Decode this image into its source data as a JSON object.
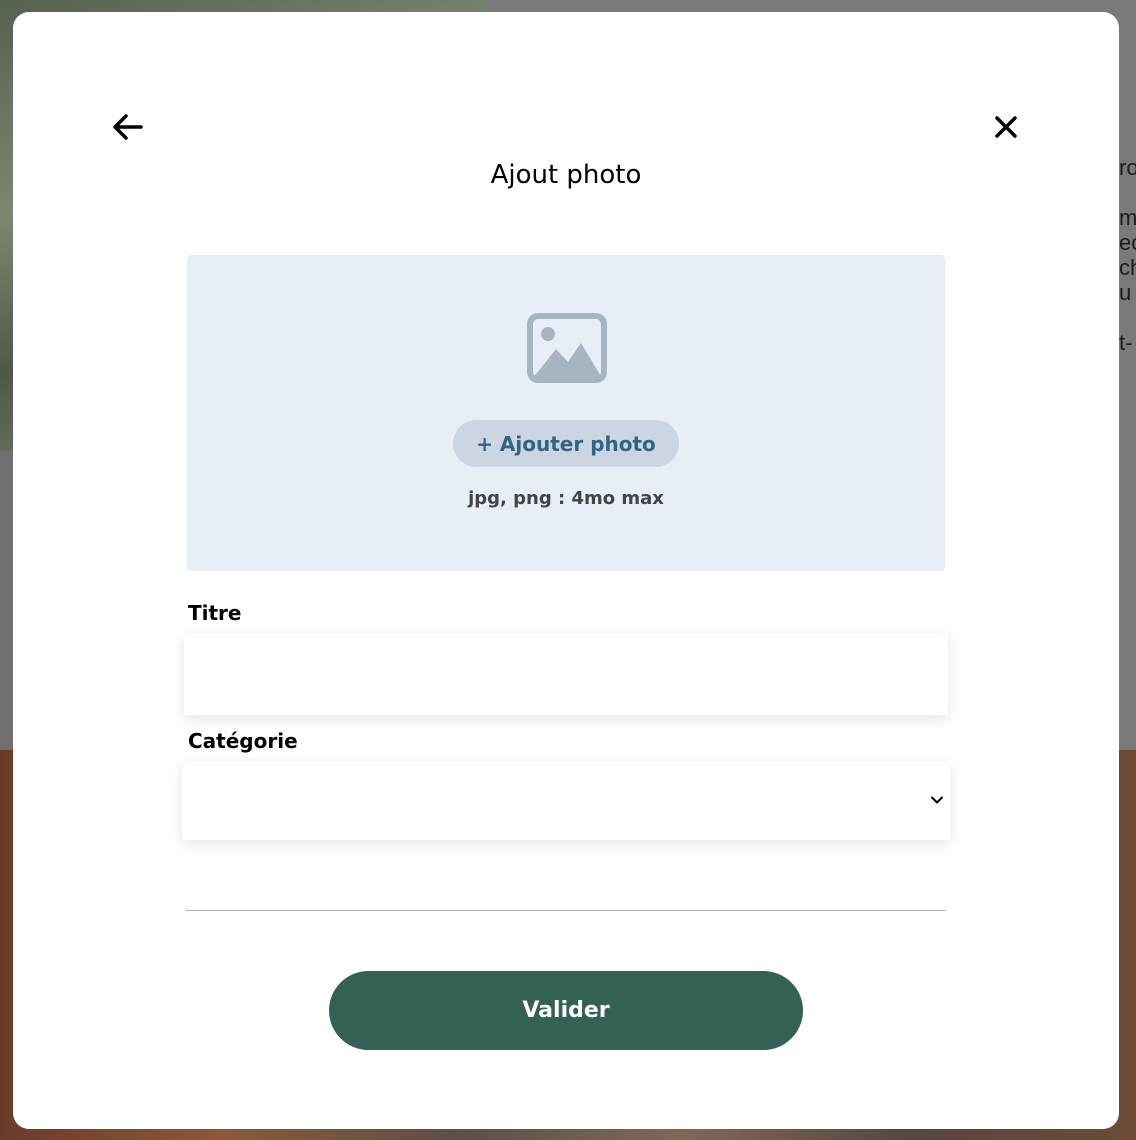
{
  "modal": {
    "title": "Ajout photo",
    "back_icon": "arrow-left-icon",
    "close_icon": "close-icon"
  },
  "upload": {
    "image_icon": "image-placeholder-icon",
    "button_label": "+ Ajouter photo",
    "hint": "jpg, png : 4mo max"
  },
  "form": {
    "title_label": "Titre",
    "title_value": "",
    "category_label": "Catégorie",
    "category_value": "",
    "category_icon": "chevron-down-icon"
  },
  "actions": {
    "submit_label": "Valider"
  },
  "background": {
    "partial_text": "ro\n\nm\nec\nch\nu\n\nt-"
  },
  "colors": {
    "submit_bg": "#336155",
    "upload_zone_bg": "#e8eef6",
    "add_photo_bg": "#cbd6e2",
    "add_photo_text": "#306685",
    "icon_gray": "#a7b4c2"
  }
}
